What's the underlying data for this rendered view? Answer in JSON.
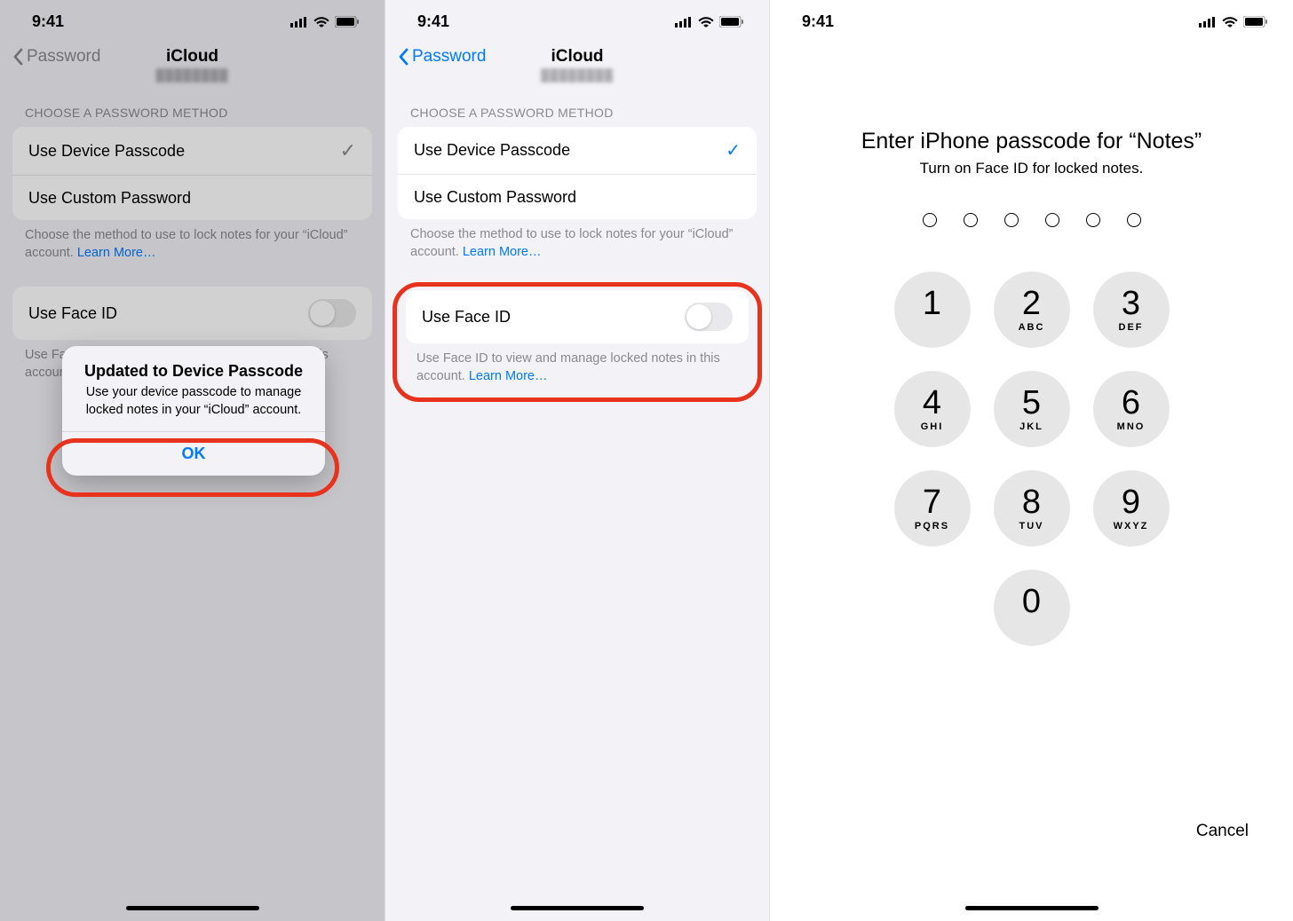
{
  "status": {
    "time": "9:41"
  },
  "screen1": {
    "back_label": "Password",
    "title": "iCloud",
    "section_header": "CHOOSE A PASSWORD METHOD",
    "opt1": "Use Device Passcode",
    "opt2": "Use Custom Password",
    "footer_text": "Choose the method to use to lock notes for your “iCloud” account. ",
    "learn_more": "Learn More…",
    "faceid_label": "Use Face ID",
    "faceid_footer": "Use Face ID to view and manage locked notes in this account. ",
    "alert_title": "Updated to Device Passcode",
    "alert_msg": "Use your device passcode to manage locked notes in your “iCloud” account.",
    "alert_ok": "OK"
  },
  "screen2": {
    "back_label": "Password",
    "title": "iCloud",
    "section_header": "CHOOSE A PASSWORD METHOD",
    "opt1": "Use Device Passcode",
    "opt2": "Use Custom Password",
    "footer_text": "Choose the method to use to lock notes for your “iCloud” account. ",
    "learn_more": "Learn More…",
    "faceid_label": "Use Face ID",
    "faceid_footer": "Use Face ID to view and manage locked notes in this account. "
  },
  "screen3": {
    "title": "Enter iPhone passcode for “Notes”",
    "subtitle": "Turn on Face ID for locked notes.",
    "cancel": "Cancel",
    "keys": [
      {
        "num": "1",
        "letters": ""
      },
      {
        "num": "2",
        "letters": "ABC"
      },
      {
        "num": "3",
        "letters": "DEF"
      },
      {
        "num": "4",
        "letters": "GHI"
      },
      {
        "num": "5",
        "letters": "JKL"
      },
      {
        "num": "6",
        "letters": "MNO"
      },
      {
        "num": "7",
        "letters": "PQRS"
      },
      {
        "num": "8",
        "letters": "TUV"
      },
      {
        "num": "9",
        "letters": "WXYZ"
      },
      {
        "num": "0",
        "letters": ""
      }
    ]
  }
}
